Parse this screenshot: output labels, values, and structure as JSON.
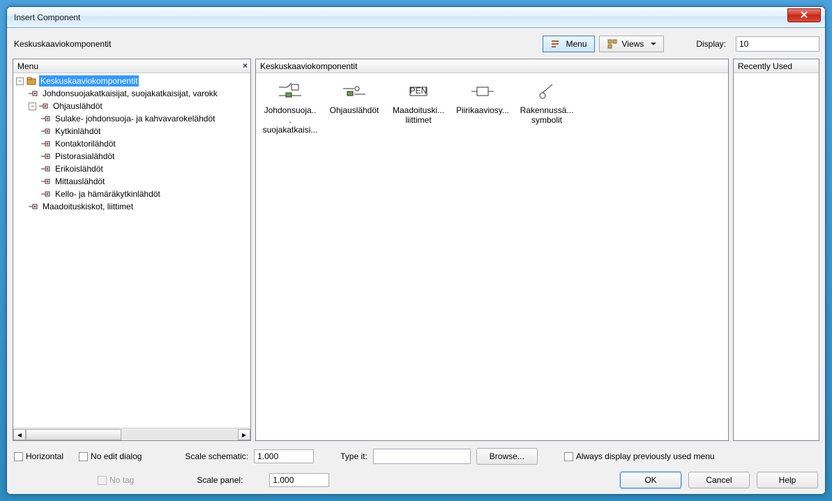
{
  "title": "Insert Component",
  "header_label": "Keskuskaaviokomponentit",
  "toolbar": {
    "menu_label": "Menu",
    "views_label": "Views",
    "display_label": "Display:",
    "display_value": "10"
  },
  "left_panel": {
    "title": "Menu"
  },
  "tree": {
    "root": "Keskuskaaviokomponentit",
    "n1": "Johdonsuojakatkaisijat, suojakatkaisijat, varokk",
    "n2": "Ohjauslähdöt",
    "n2_1": "Sulake- johdonsuoja- ja kahvavarokelähdöt",
    "n2_2": "Kytkinlähdöt",
    "n2_3": "Kontaktorilähdöt",
    "n2_4": "Pistorasialähdöt",
    "n2_5": "Erikoislähdöt",
    "n2_6": "Mittauslähdöt",
    "n2_7": "Kello- ja hämäräkytkinlähdöt",
    "n3": "Maadoituskiskot, liittimet"
  },
  "center_panel": {
    "title": "Keskuskaaviokomponentit",
    "items": [
      {
        "l1": "Johdonsuoja...",
        "l2": "suojakatkaisi..."
      },
      {
        "l1": "Ohjauslähdöt",
        "l2": ""
      },
      {
        "l1": "Maadoituski...",
        "l2": "liittimet"
      },
      {
        "l1": "Piirikaaviosy...",
        "l2": ""
      },
      {
        "l1": "Rakennussä...",
        "l2": "symbolit"
      }
    ]
  },
  "right_panel": {
    "title": "Recently Used"
  },
  "footer": {
    "horizontal": "Horizontal",
    "no_edit": "No edit dialog",
    "no_tag": "No tag",
    "scale_schematic_label": "Scale schematic:",
    "scale_schematic_value": "1.000",
    "scale_panel_label": "Scale panel:",
    "scale_panel_value": "1.000",
    "type_it_label": "Type it:",
    "browse_label": "Browse...",
    "always_display": "Always display previously used menu",
    "ok": "OK",
    "cancel": "Cancel",
    "help": "Help"
  }
}
